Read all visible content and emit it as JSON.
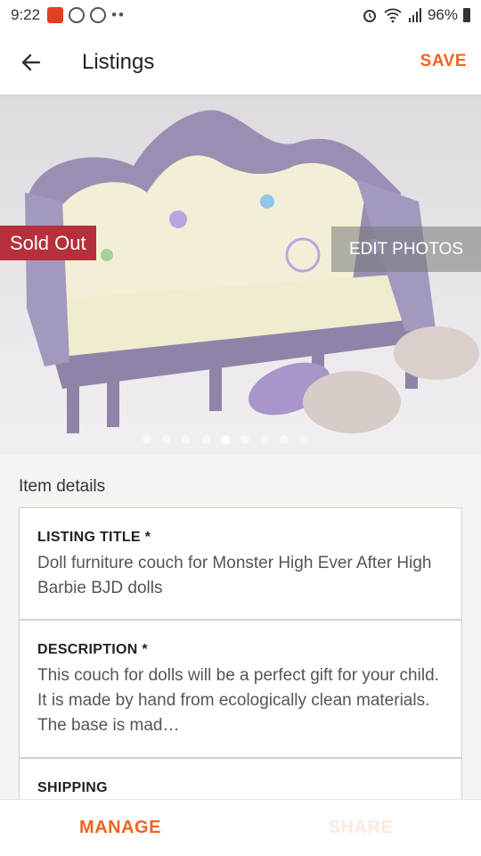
{
  "status_bar": {
    "time": "9:22",
    "dots": "••",
    "battery": "96%",
    "icons": [
      "notification-mail-icon",
      "viber-icon",
      "viber-icon",
      "alarm-icon",
      "wifi-icon",
      "signal-icon",
      "battery-icon"
    ]
  },
  "app_bar": {
    "back_icon": "arrow-left-icon",
    "title": "Listings",
    "save_label": "SAVE"
  },
  "photo": {
    "sold_badge": "Sold Out",
    "edit_photos_label": "EDIT PHOTOS",
    "page_count": 9,
    "current_page": 5
  },
  "item_details": {
    "section_title": "Item details",
    "listing_title_label": "LISTING TITLE *",
    "listing_title_value": "Doll furniture couch for Monster High Ever After High Barbie BJD dolls",
    "description_label": "DESCRIPTION *",
    "description_value": "This couch for dolls will be a perfect gift for your child. It is made by hand from ecologically clean materials. The base is mad…",
    "shipping_label": "SHIPPING"
  },
  "bottom_bar": {
    "manage_label": "MANAGE",
    "share_label": "SHARE"
  },
  "colors": {
    "accent": "#f1641e",
    "sold_badge": "#b5303b"
  }
}
